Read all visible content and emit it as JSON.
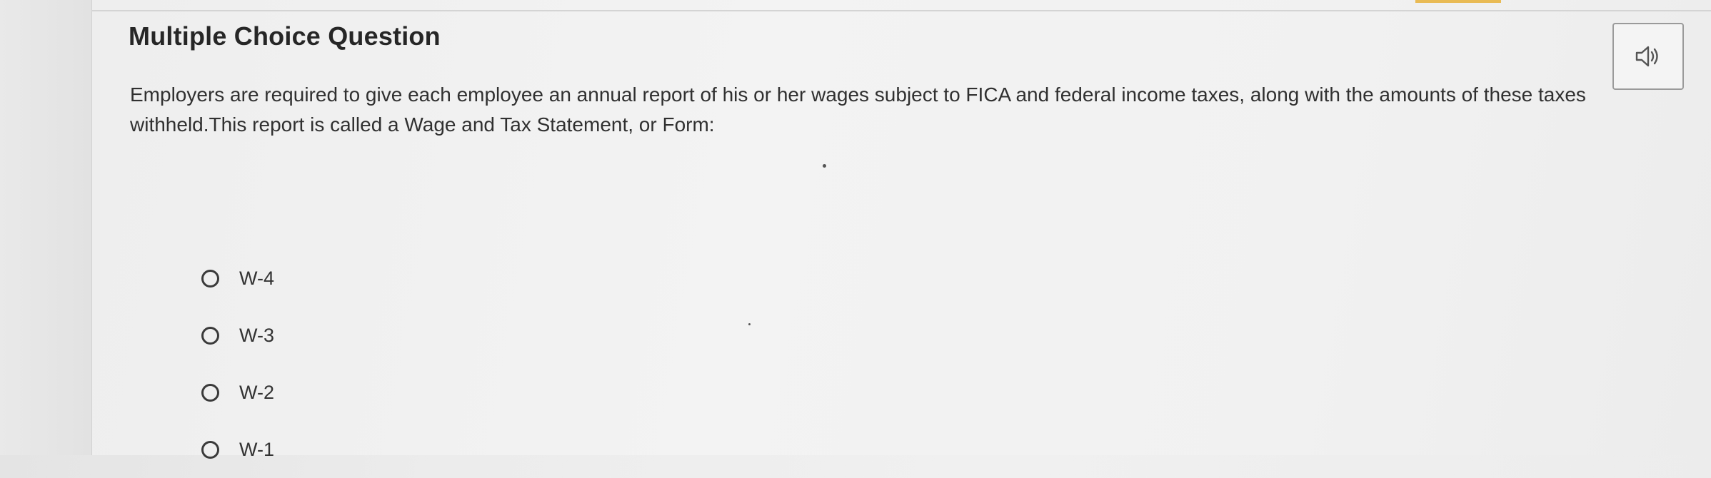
{
  "question": {
    "heading": "Multiple Choice Question",
    "text": "Employers are required to give each employee an annual report of his or her wages subject to FICA and federal income taxes, along with the amounts of these taxes withheld.This report is called a Wage and Tax Statement, or Form:",
    "audio_icon": "speaker-icon"
  },
  "options": [
    {
      "label": "W-4"
    },
    {
      "label": "W-3"
    },
    {
      "label": "W-2"
    },
    {
      "label": "W-1"
    }
  ],
  "colors": {
    "text": "#2b2b2b",
    "border": "#9a9a9a",
    "accent": "#e8b23a"
  }
}
